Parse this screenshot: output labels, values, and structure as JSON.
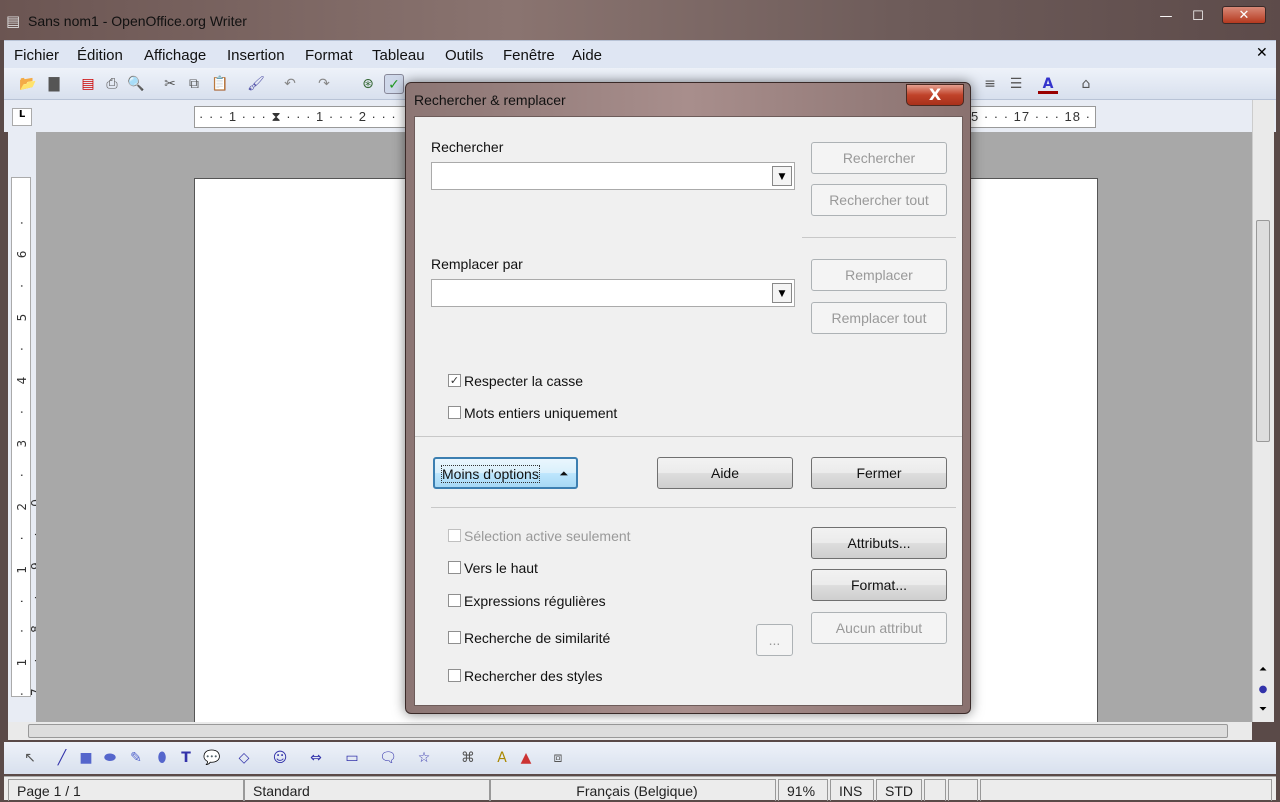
{
  "window": {
    "title": "Sans nom1 - OpenOffice.org Writer",
    "minimize": "—",
    "maximize": "☐",
    "close": "✕",
    "doc_close": "✕"
  },
  "menu": [
    "Fichier",
    "Édition",
    "Affichage",
    "Insertion",
    "Format",
    "Tableau",
    "Outils",
    "Fenêtre",
    "Aide"
  ],
  "ruler": {
    "left_text": "· · · 1 · · · ⧗ · · · 1 · · · 2 · · ·",
    "right_text": "5 · · · 17 · · · 18 · · ·",
    "tab_icon": "L"
  },
  "vruler": "· 1 · · 1 · 2 · 3 · 4 · 5 · 6 · 7 · 8 · 9 · 0",
  "toolbar_icons": [
    "open-icon",
    "save-icon",
    "pdf-icon",
    "print-icon",
    "preview-icon",
    "cut-icon",
    "copy-icon",
    "paste-icon",
    "format-paintbrush-icon",
    "undo-icon",
    "redo-icon",
    "navigator-icon",
    "spellcheck-icon"
  ],
  "toolbar_right_icons": [
    "align-right-icon",
    "justify-icon",
    "font-color-icon",
    "highlight-icon"
  ],
  "dialog": {
    "title": "Rechercher & remplacer",
    "close": "X",
    "search_label": "Rechercher",
    "search_value": "",
    "replace_label": "Remplacer par",
    "replace_value": "",
    "btn_search": "Rechercher",
    "btn_search_all": "Rechercher tout",
    "btn_replace": "Remplacer",
    "btn_replace_all": "Remplacer tout",
    "match_case": {
      "label": "Respecter la casse",
      "checked": true
    },
    "whole_words": {
      "label": "Mots entiers uniquement",
      "checked": false
    },
    "btn_less_options": "Moins d'options",
    "btn_help": "Aide",
    "btn_close": "Fermer",
    "current_selection": {
      "label": "Sélection active seulement",
      "checked": false,
      "disabled": true
    },
    "backwards": {
      "label": "Vers le haut",
      "checked": false
    },
    "regex": {
      "label": "Expressions régulières",
      "checked": false
    },
    "similarity": {
      "label": "Recherche de similarité",
      "checked": false
    },
    "styles": {
      "label": "Rechercher des styles",
      "checked": false
    },
    "btn_attributes": "Attributs...",
    "btn_format": "Format...",
    "btn_no_attr": "Aucun attribut",
    "btn_similarity_opts": "..."
  },
  "status": {
    "page": "Page 1 / 1",
    "style": "Standard",
    "language": "Français (Belgique)",
    "zoom": "91%",
    "insert": "INS",
    "select": "STD"
  }
}
